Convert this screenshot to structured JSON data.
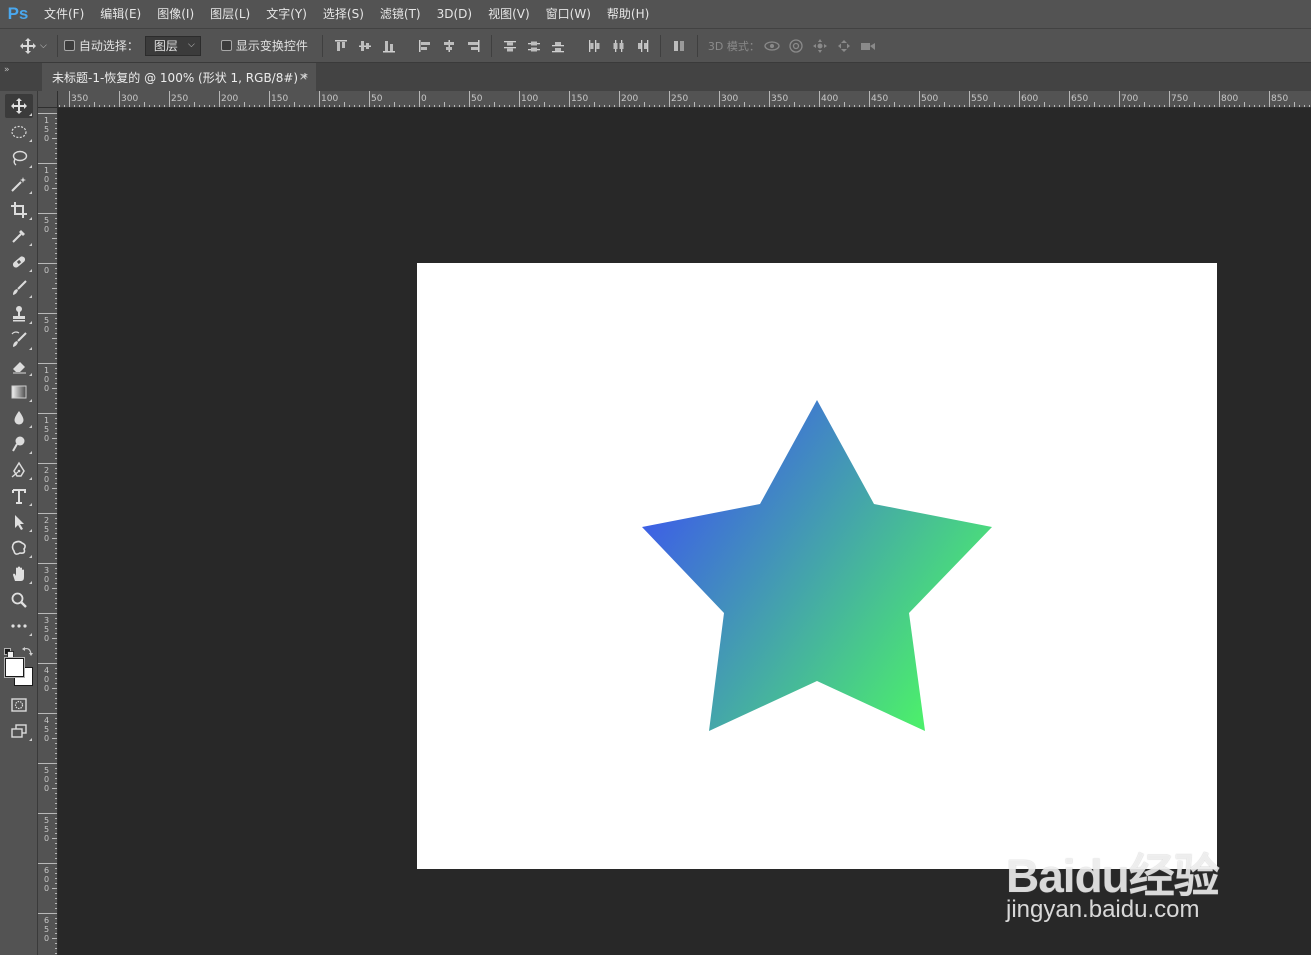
{
  "app": {
    "logo": "Ps"
  },
  "menu": [
    {
      "label": "文件(F)"
    },
    {
      "label": "编辑(E)"
    },
    {
      "label": "图像(I)"
    },
    {
      "label": "图层(L)"
    },
    {
      "label": "文字(Y)"
    },
    {
      "label": "选择(S)"
    },
    {
      "label": "滤镜(T)"
    },
    {
      "label": "3D(D)"
    },
    {
      "label": "视图(V)"
    },
    {
      "label": "窗口(W)"
    },
    {
      "label": "帮助(H)"
    }
  ],
  "options": {
    "auto_select_label": "自动选择：",
    "auto_select_checked": false,
    "auto_select_target": "图层",
    "show_transform_label": "显示变换控件",
    "show_transform_checked": false,
    "mode_3d_label": "3D 模式："
  },
  "document": {
    "tab_title": "未标题-1-恢复的 @ 100% (形状 1, RGB/8#) *",
    "close_symbol": "×"
  },
  "rulers": {
    "horizontal": [
      "350",
      "300",
      "250",
      "200",
      "150",
      "100",
      "50",
      "0",
      "50",
      "100",
      "150",
      "200",
      "250",
      "300",
      "350",
      "400",
      "450",
      "500",
      "550",
      "600",
      "650",
      "700",
      "750",
      "800",
      "850"
    ],
    "vertical": [
      "150",
      "100",
      "50",
      "0",
      "50",
      "100",
      "150",
      "200",
      "250",
      "300",
      "350",
      "400",
      "450",
      "500",
      "550",
      "600",
      "650"
    ]
  },
  "canvas": {
    "background": "#ffffff",
    "shape": "star",
    "gradient_start": "#3d5fe6",
    "gradient_end": "#4cee6c"
  },
  "colors": {
    "foreground": "#ffffff",
    "background": "#ffffff",
    "ui_panel": "#535353",
    "workspace": "#282828",
    "ps_blue": "#4aa8ef"
  },
  "tools": [
    "move-tool",
    "marquee-tool",
    "lasso-tool",
    "magic-wand-tool",
    "crop-tool",
    "eyedropper-tool",
    "healing-brush-tool",
    "brush-tool",
    "clone-stamp-tool",
    "history-brush-tool",
    "eraser-tool",
    "gradient-tool",
    "blur-tool",
    "dodge-tool",
    "pen-tool",
    "type-tool",
    "path-selection-tool",
    "custom-shape-tool",
    "hand-tool",
    "zoom-tool",
    "edit-toolbar"
  ],
  "watermark": {
    "brand": "Baidu经验",
    "url": "jingyan.baidu.com"
  }
}
